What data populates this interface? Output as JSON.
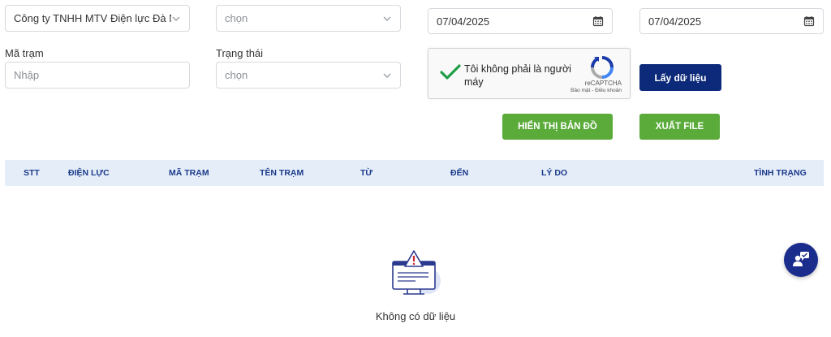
{
  "filters": {
    "company": {
      "value": "Công ty TNHH MTV Điện lực Đà N..."
    },
    "type_select": {
      "value": "chọn"
    },
    "date_from": {
      "value": "07/04/2025"
    },
    "date_to": {
      "value": "07/04/2025"
    },
    "station_code": {
      "label": "Mã trạm",
      "placeholder": "Nhập"
    },
    "status": {
      "label": "Trạng thái",
      "value": "chọn"
    }
  },
  "captcha": {
    "text": "Tôi không phải là người máy",
    "brand": "reCAPTCHA",
    "terms": "Bảo mật - Điều khoản"
  },
  "buttons": {
    "fetch": "Lấy dữ liệu",
    "show_map": "HIỂN THỊ BẢN ĐỒ",
    "export": "XUẤT FILE"
  },
  "table": {
    "columns": [
      "STT",
      "ĐIỆN LỰC",
      "MÃ TRẠM",
      "TÊN TRẠM",
      "TỪ",
      "ĐẾN",
      "LÝ DO",
      "TÌNH TRẠNG"
    ]
  },
  "empty_state": {
    "text": "Không có dữ liệu",
    "icon": "warning-monitor-icon"
  },
  "chat": {
    "icon": "chat-support-icon"
  },
  "colors": {
    "navy": "#0d2a7a",
    "green": "#5bab3b",
    "header_bg": "#e5edf9",
    "header_text": "#1b3a8a"
  }
}
